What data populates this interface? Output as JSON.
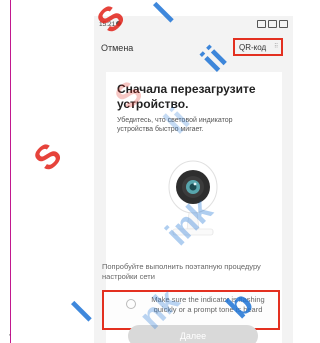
{
  "status_bar": {
    "time": "15:21"
  },
  "header": {
    "cancel_label": "Отмена",
    "qr_label": "QR-код",
    "qr_icon": "⠿"
  },
  "card": {
    "title": "Сначала перезагрузите устройство.",
    "description": "Убедитесь, что световой индикатор устройства быстро мигает.",
    "factory_reset_text": "Попробуйте выполнить поэтапную процедуру настройки сети",
    "indicator_confirm_text": "Make sure the indicator is flashing quickly or a prompt tone is heard",
    "next_button_label": "Далее"
  },
  "colors": {
    "highlight": "#e33020",
    "watermark_red": "#e2231a",
    "watermark_blue": "#1e74d6"
  },
  "icons": [
    "battery-icon",
    "wifi-icon",
    "signal-icon",
    "qr-code-icon",
    "camera-illustration-icon"
  ]
}
